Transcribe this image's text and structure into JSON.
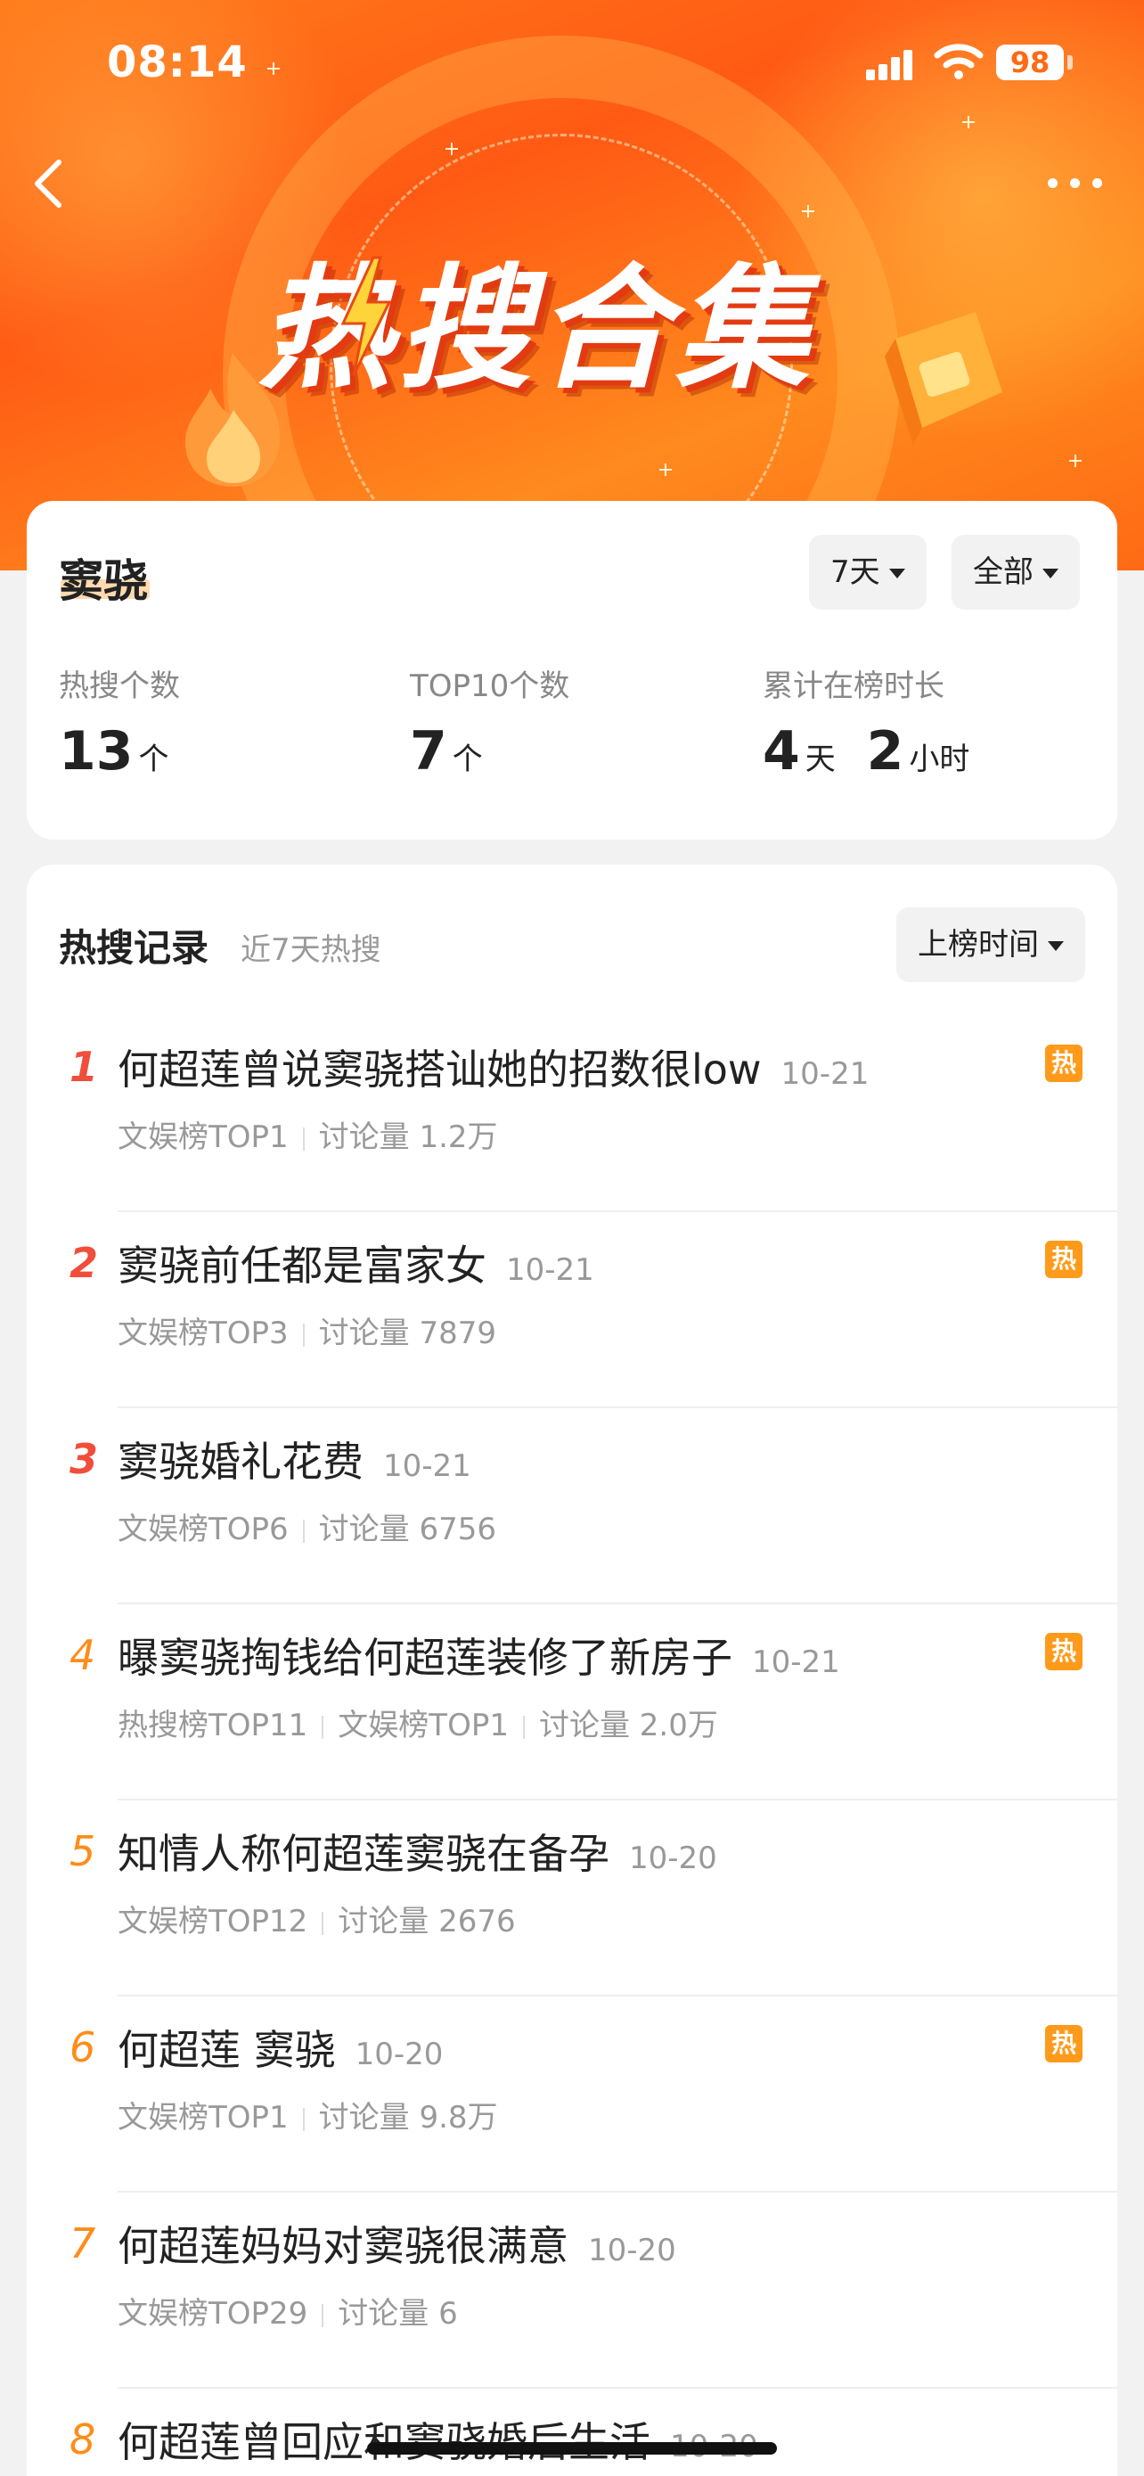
{
  "status_bar": {
    "time": "08:14",
    "battery": "98"
  },
  "banner": {
    "title": "热搜合集"
  },
  "summary": {
    "person_name": "窦骁",
    "filters": {
      "period": "7天",
      "category": "全部"
    },
    "stats": [
      {
        "label": "热搜个数",
        "parts": [
          {
            "value": "13",
            "unit": "个"
          }
        ]
      },
      {
        "label": "TOP10个数",
        "parts": [
          {
            "value": "7",
            "unit": "个"
          }
        ]
      },
      {
        "label": "累计在榜时长",
        "parts": [
          {
            "value": "4",
            "unit": "天"
          },
          {
            "value": "2",
            "unit": "小时"
          }
        ]
      }
    ]
  },
  "records": {
    "title": "热搜记录",
    "subtitle": "近7天热搜",
    "sort_label": "上榜时间",
    "hot_badge": "热",
    "items": [
      {
        "rank": "1",
        "title": "何超莲曾说窦骁搭讪她的招数很low",
        "date": "10-21",
        "meta": [
          "文娱榜TOP1",
          "讨论量 1.2万"
        ],
        "hot": true
      },
      {
        "rank": "2",
        "title": "窦骁前任都是富家女",
        "date": "10-21",
        "meta": [
          "文娱榜TOP3",
          "讨论量 7879"
        ],
        "hot": true
      },
      {
        "rank": "3",
        "title": "窦骁婚礼花费",
        "date": "10-21",
        "meta": [
          "文娱榜TOP6",
          "讨论量 6756"
        ],
        "hot": false
      },
      {
        "rank": "4",
        "title": "曝窦骁掏钱给何超莲装修了新房子",
        "date": "10-21",
        "meta": [
          "热搜榜TOP11",
          "文娱榜TOP1",
          "讨论量 2.0万"
        ],
        "hot": true
      },
      {
        "rank": "5",
        "title": "知情人称何超莲窦骁在备孕",
        "date": "10-20",
        "meta": [
          "文娱榜TOP12",
          "讨论量 2676"
        ],
        "hot": false
      },
      {
        "rank": "6",
        "title": "何超莲 窦骁",
        "date": "10-20",
        "meta": [
          "文娱榜TOP1",
          "讨论量 9.8万"
        ],
        "hot": true
      },
      {
        "rank": "7",
        "title": "何超莲妈妈对窦骁很满意",
        "date": "10-20",
        "meta": [
          "文娱榜TOP29",
          "讨论量 6"
        ],
        "hot": false
      },
      {
        "rank": "8",
        "title": "何超莲曾回应和窦骁婚后生活",
        "date": "10-20",
        "meta": [],
        "hot": false
      }
    ]
  },
  "colors": {
    "accent": "#ff6a14",
    "rank_top": "#f04e3b",
    "rank_other": "#ff8c1a",
    "hot_badge": "#ff9a1a"
  }
}
